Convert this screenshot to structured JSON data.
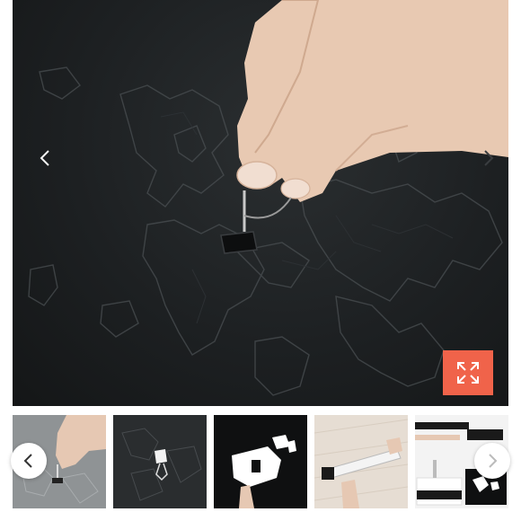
{
  "gallery": {
    "icons": {
      "prev": "chevron-left-icon",
      "next": "chevron-right-icon",
      "expand": "expand-arrows-icon"
    },
    "colors": {
      "expand_button": "#f0634a",
      "board": "#1d2022",
      "arrow_circle": "#ffffff"
    },
    "thumbnails": [
      {
        "name": "hand-pin-on-grey-map"
      },
      {
        "name": "white-pin-on-dark-map"
      },
      {
        "name": "hand-holding-white-map-piece"
      },
      {
        "name": "person-with-rolled-map-tube"
      },
      {
        "name": "packaging-and-map-collage"
      }
    ]
  }
}
